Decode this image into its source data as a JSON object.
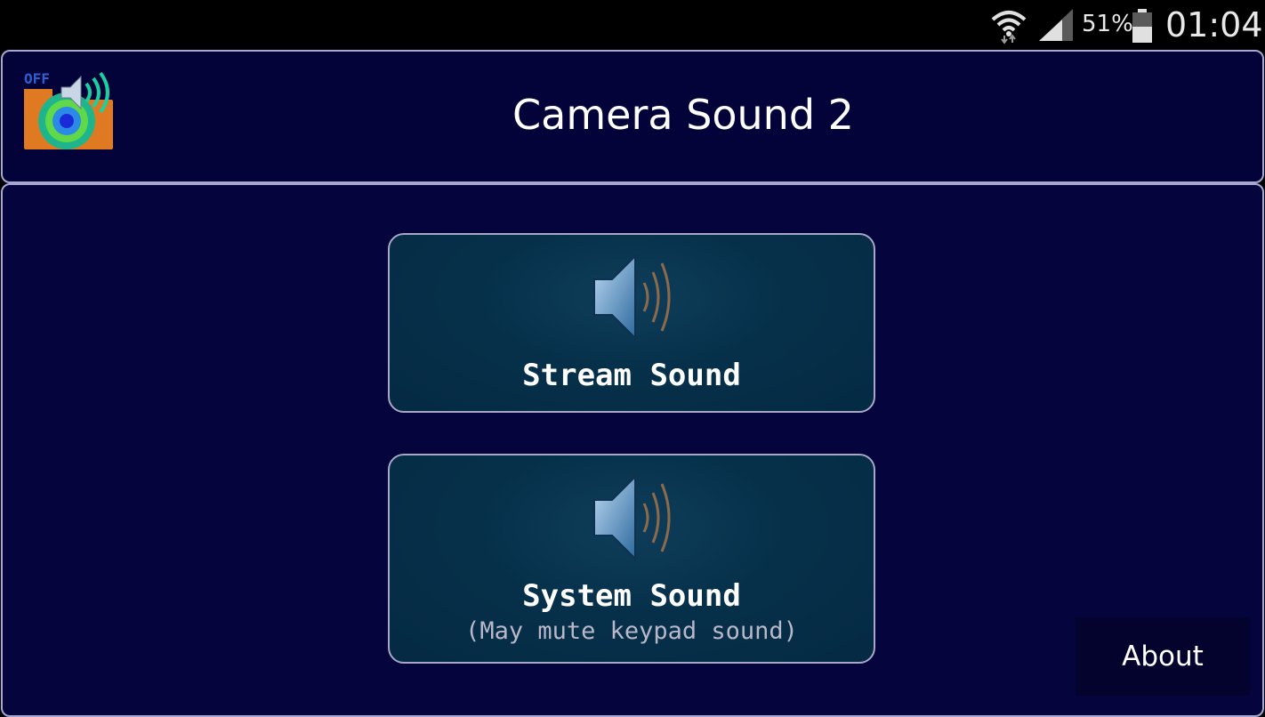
{
  "status_bar": {
    "battery_percent": "51%",
    "time": "01:04",
    "icons": [
      "wifi-icon",
      "signal-icon",
      "battery-icon"
    ]
  },
  "header": {
    "title": "Camera Sound 2",
    "icon_label": "OFF"
  },
  "buttons": {
    "stream": {
      "label": "Stream Sound"
    },
    "system": {
      "label": "System Sound",
      "sublabel": "(May mute keypad sound)"
    }
  },
  "about": {
    "label": "About"
  },
  "colors": {
    "background": "#03033a",
    "panel_border": "#a7a7d2",
    "button_bg": "#06304a",
    "text": "#ffffff",
    "subtext": "#b8b8c8"
  }
}
